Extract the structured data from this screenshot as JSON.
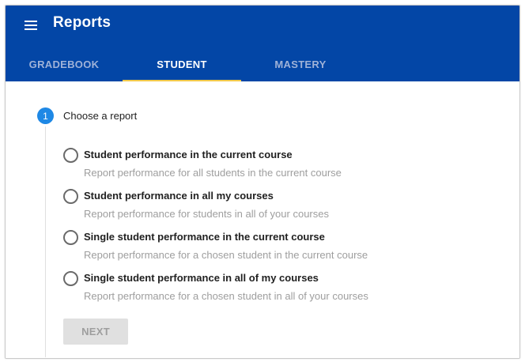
{
  "header": {
    "title": "Reports",
    "menu_icon": "hamburger-menu-icon",
    "background_color": "#0346a6"
  },
  "tabs": [
    {
      "label": "GRADEBOOK",
      "active": false
    },
    {
      "label": "STUDENT",
      "active": true
    },
    {
      "label": "MASTERY",
      "active": false
    }
  ],
  "accent_color": "#f2c94c",
  "stepper": {
    "step_number": "1",
    "step_title": "Choose a report",
    "step_color": "#1e88e5"
  },
  "options": [
    {
      "title": "Student performance in the current course",
      "description": "Report performance for all students in the current course",
      "selected": false
    },
    {
      "title": "Student performance in all my courses",
      "description": "Report performance for students in all of your courses",
      "selected": false
    },
    {
      "title": "Single student performance in the current course",
      "description": "Report performance for a chosen student in the current course",
      "selected": false
    },
    {
      "title": "Single student performance in all of my courses",
      "description": "Report performance for a chosen student in all of your courses",
      "selected": false
    }
  ],
  "next_button": {
    "label": "NEXT",
    "disabled": true
  }
}
